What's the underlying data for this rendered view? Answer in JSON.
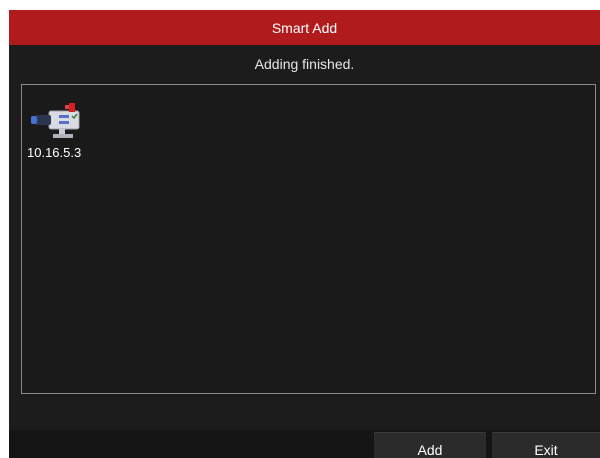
{
  "dialog": {
    "title": "Smart Add",
    "status_message": "Adding finished."
  },
  "devices": [
    {
      "label": "10.16.5.3",
      "icon": "ip-camera-icon"
    }
  ],
  "buttons": {
    "add_label": "Add",
    "exit_label": "Exit"
  },
  "colors": {
    "title_bar": "#b01b1e",
    "dialog_background": "#1c1c1c",
    "panel_border": "#8a8a8a"
  }
}
